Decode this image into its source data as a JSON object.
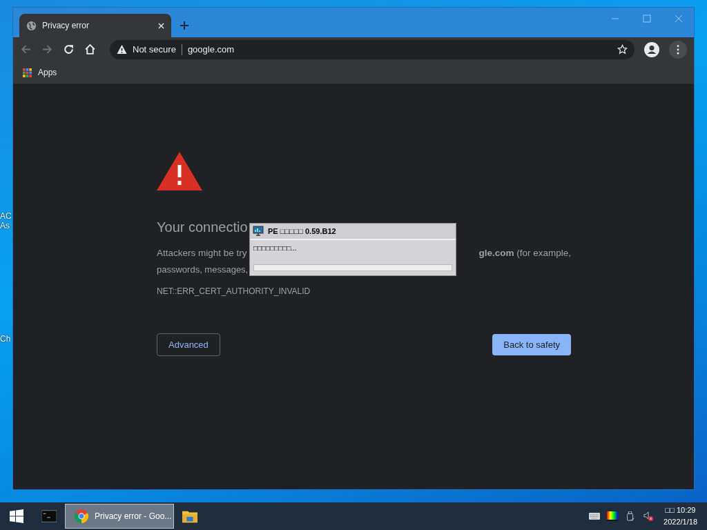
{
  "desktop": {
    "icons": [
      {
        "lines": [
          "AC",
          "As"
        ]
      },
      {
        "lines": [
          "Ch"
        ]
      }
    ]
  },
  "browser": {
    "tabs": [
      {
        "title": "Privacy error",
        "selected": true
      }
    ],
    "address": {
      "security": "Not secure",
      "url": "google.com"
    },
    "bookmarks": [
      "Apps"
    ],
    "page": {
      "heading": "Your connectio",
      "line1_start": "Attackers might be try",
      "line1_end": "**gle.com** (for example,",
      "line2": "passwords, messages,",
      "error_code": "NET::ERR_CERT_AUTHORITY_INVALID",
      "buttons": [
        {
          "label": "Advanced",
          "kind": "secondary"
        },
        {
          "label": "Back to safety",
          "kind": "primary"
        }
      ]
    }
  },
  "dialog": {
    "title": "PE □□□□□ 0.59.B12",
    "message": "□□□□□□□□□...",
    "level": 0
  },
  "taskbar": {
    "items": [
      {
        "kind": "terminal",
        "selected": false
      },
      {
        "kind": "browser",
        "label": "Privacy error - Goo...",
        "selected": true
      },
      {
        "kind": "folder",
        "selected": false
      }
    ],
    "clock": {
      "time": "□□ 10:29",
      "date": "2022/1/18"
    }
  }
}
